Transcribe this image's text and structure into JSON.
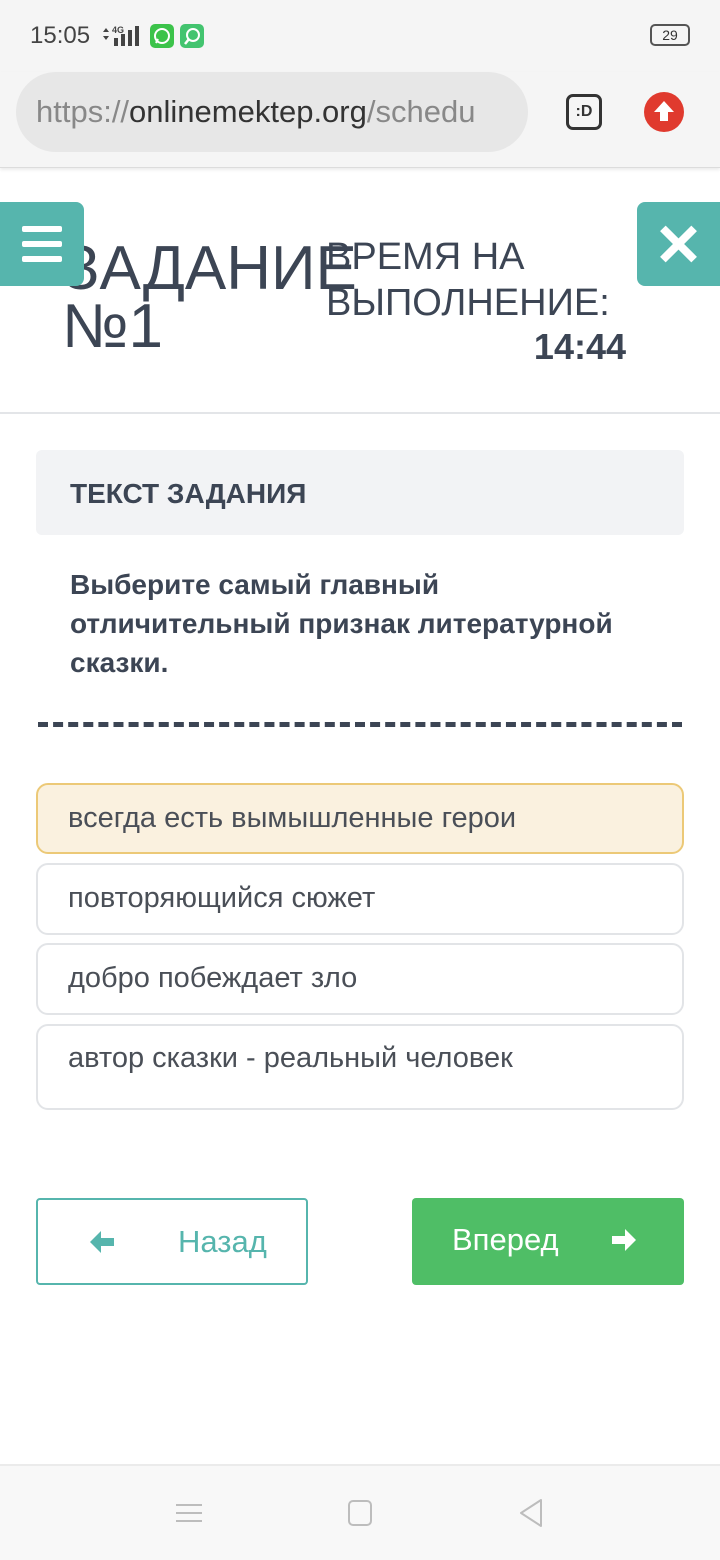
{
  "status_bar": {
    "time": "15:05",
    "network": "4G",
    "battery": "29",
    "icons": [
      "signal-icon",
      "whatsapp-icon",
      "messenger-icon",
      "battery-icon"
    ]
  },
  "browser": {
    "url_scheme": "https://",
    "url_host": "onlinemektep.org",
    "url_path": "/schedu",
    "tab_label": ":D",
    "icons": [
      "tab-switcher-icon",
      "upload-icon"
    ]
  },
  "header": {
    "task_title": "ЗАДАНИЕ №1",
    "time_label": "ВРЕМЯ НА ВЫПОЛНЕНИЕ:",
    "time_value": "14:44",
    "icons": [
      "hamburger-menu-icon",
      "close-icon"
    ]
  },
  "question": {
    "heading": "ТЕКСТ ЗАДАНИЯ",
    "text": "Выберите самый главный отличительный признак литературной сказки."
  },
  "answers": [
    {
      "label": "всегда есть вымышленные герои",
      "selected": true
    },
    {
      "label": "повторяющийся сюжет",
      "selected": false
    },
    {
      "label": "добро побеждает зло",
      "selected": false
    },
    {
      "label": "автор сказки - реальный человек",
      "selected": false
    }
  ],
  "navigation": {
    "back_label": "Назад",
    "next_label": "Вперед",
    "icons": [
      "arrow-left-icon",
      "arrow-right-icon"
    ]
  },
  "colors": {
    "accent_teal": "#56b5ad",
    "accent_green": "#4fbe66",
    "selected_bg": "#faf1df",
    "selected_border": "#ecc977",
    "text_dark": "#3c4554"
  }
}
